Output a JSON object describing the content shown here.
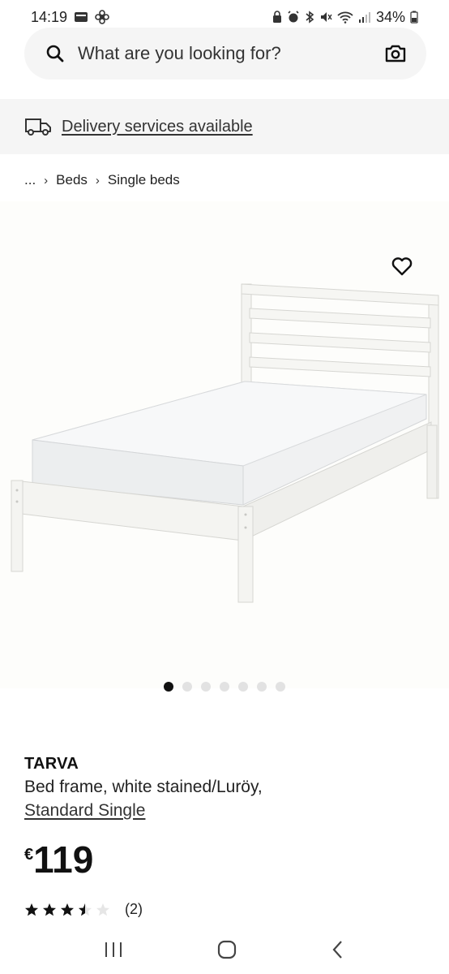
{
  "status_bar": {
    "time": "14:19",
    "battery": "34%"
  },
  "search": {
    "placeholder": "What are you looking for?",
    "search_icon": "search-icon",
    "camera_icon": "camera-icon"
  },
  "delivery": {
    "icon": "truck-icon",
    "label": "Delivery services available"
  },
  "breadcrumb": {
    "ellipsis": "...",
    "items": [
      "Beds",
      "Single beds"
    ]
  },
  "gallery": {
    "dot_count": 7,
    "active_index": 0
  },
  "product": {
    "name": "TARVA",
    "description": "Bed frame, white stained/Luröy,",
    "size": "Standard Single",
    "currency": "€",
    "price": "119",
    "rating": 3.5,
    "rating_max": 5,
    "review_count": "(2)"
  },
  "colors": {
    "text": "#111111",
    "panel": "#f5f5f5"
  }
}
